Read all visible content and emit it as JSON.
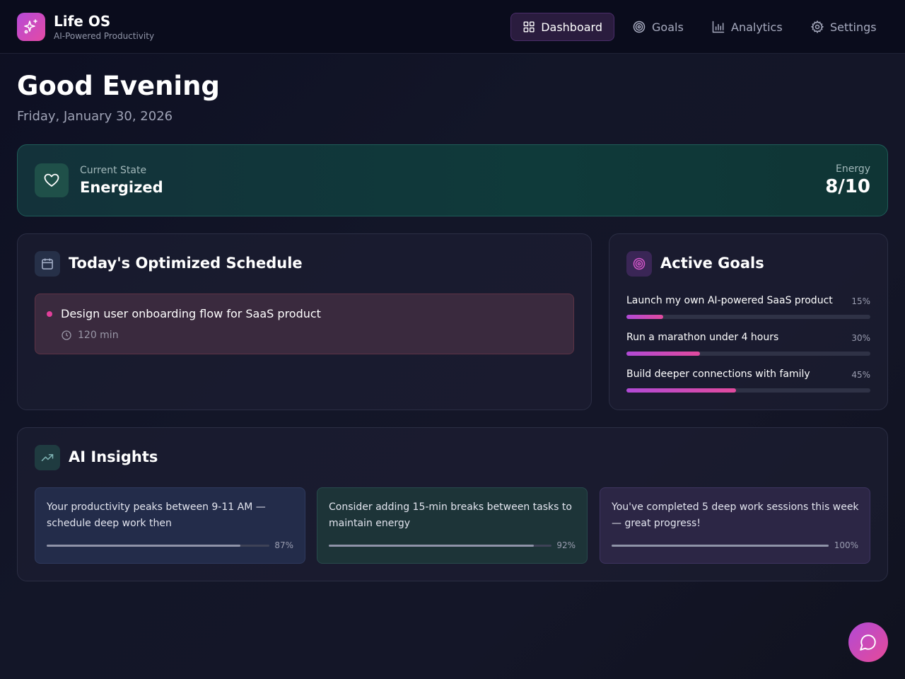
{
  "app": {
    "title": "Life OS",
    "subtitle": "AI-Powered Productivity"
  },
  "nav": [
    {
      "label": "Dashboard",
      "icon": "dashboard-icon",
      "active": true
    },
    {
      "label": "Goals",
      "icon": "target-icon",
      "active": false
    },
    {
      "label": "Analytics",
      "icon": "bar-chart-icon",
      "active": false
    },
    {
      "label": "Settings",
      "icon": "gear-icon",
      "active": false
    }
  ],
  "greeting": "Good Evening",
  "date": "Friday, January 30, 2026",
  "state": {
    "label": "Current State",
    "value": "Energized",
    "energy_label": "Energy",
    "energy_value": "8/10"
  },
  "schedule": {
    "title": "Today's Optimized Schedule",
    "tasks": [
      {
        "title": "Design user onboarding flow for SaaS product",
        "duration": "120 min"
      }
    ]
  },
  "goals": {
    "title": "Active Goals",
    "items": [
      {
        "name": "Launch my own AI-powered SaaS product",
        "pct_label": "15%",
        "progress": 0.15
      },
      {
        "name": "Run a marathon under 4 hours",
        "pct_label": "30%",
        "progress": 0.3
      },
      {
        "name": "Build deeper connections with family",
        "pct_label": "45%",
        "progress": 0.45
      }
    ]
  },
  "insights": {
    "title": "AI Insights",
    "items": [
      {
        "text": "Your productivity peaks between 9-11 AM — schedule deep work then",
        "pct_label": "87%",
        "confidence": 0.87
      },
      {
        "text": "Consider adding 15-min breaks between tasks to maintain energy",
        "pct_label": "92%",
        "confidence": 0.92
      },
      {
        "text": "You've completed 5 deep work sessions this week — great progress!",
        "pct_label": "100%",
        "confidence": 1.0
      }
    ]
  },
  "colors": {
    "accent": "#d94aa8",
    "accent_purple": "#b14ad6",
    "teal": "#0f3a3a"
  }
}
